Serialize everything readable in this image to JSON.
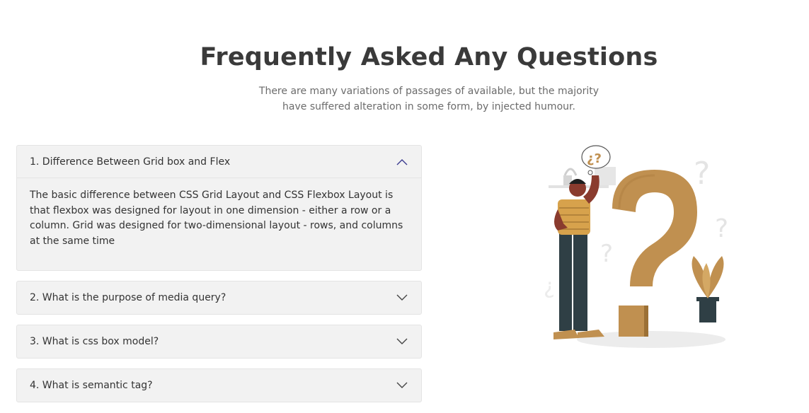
{
  "header": {
    "title": "Frequently Asked Any Questions",
    "subtitle": "There are many variations of passages of available, but the majority have suffered alteration in some form, by injected humour."
  },
  "faq": {
    "items": [
      {
        "question": "1. Difference Between Grid box and Flex",
        "answer": "The basic difference between CSS Grid Layout and CSS Flexbox Layout is that flexbox was designed for layout in one dimension - either a row or a column. Grid was designed for two-dimensional layout - rows, and columns at the same time",
        "expanded": true
      },
      {
        "question": "2. What is the purpose of media query?",
        "expanded": false
      },
      {
        "question": "3. What is css box model?",
        "expanded": false
      },
      {
        "question": "4. What is semantic tag?",
        "expanded": false
      }
    ]
  },
  "illustration": {
    "thought_bubble": "¿?",
    "colors": {
      "accent": "#c09050",
      "chevron_active": "#3b3b8f",
      "chevron": "#444444",
      "pants": "#2f3f45",
      "skin": "#8a3b2e",
      "shirt": "#d7a24c"
    }
  }
}
